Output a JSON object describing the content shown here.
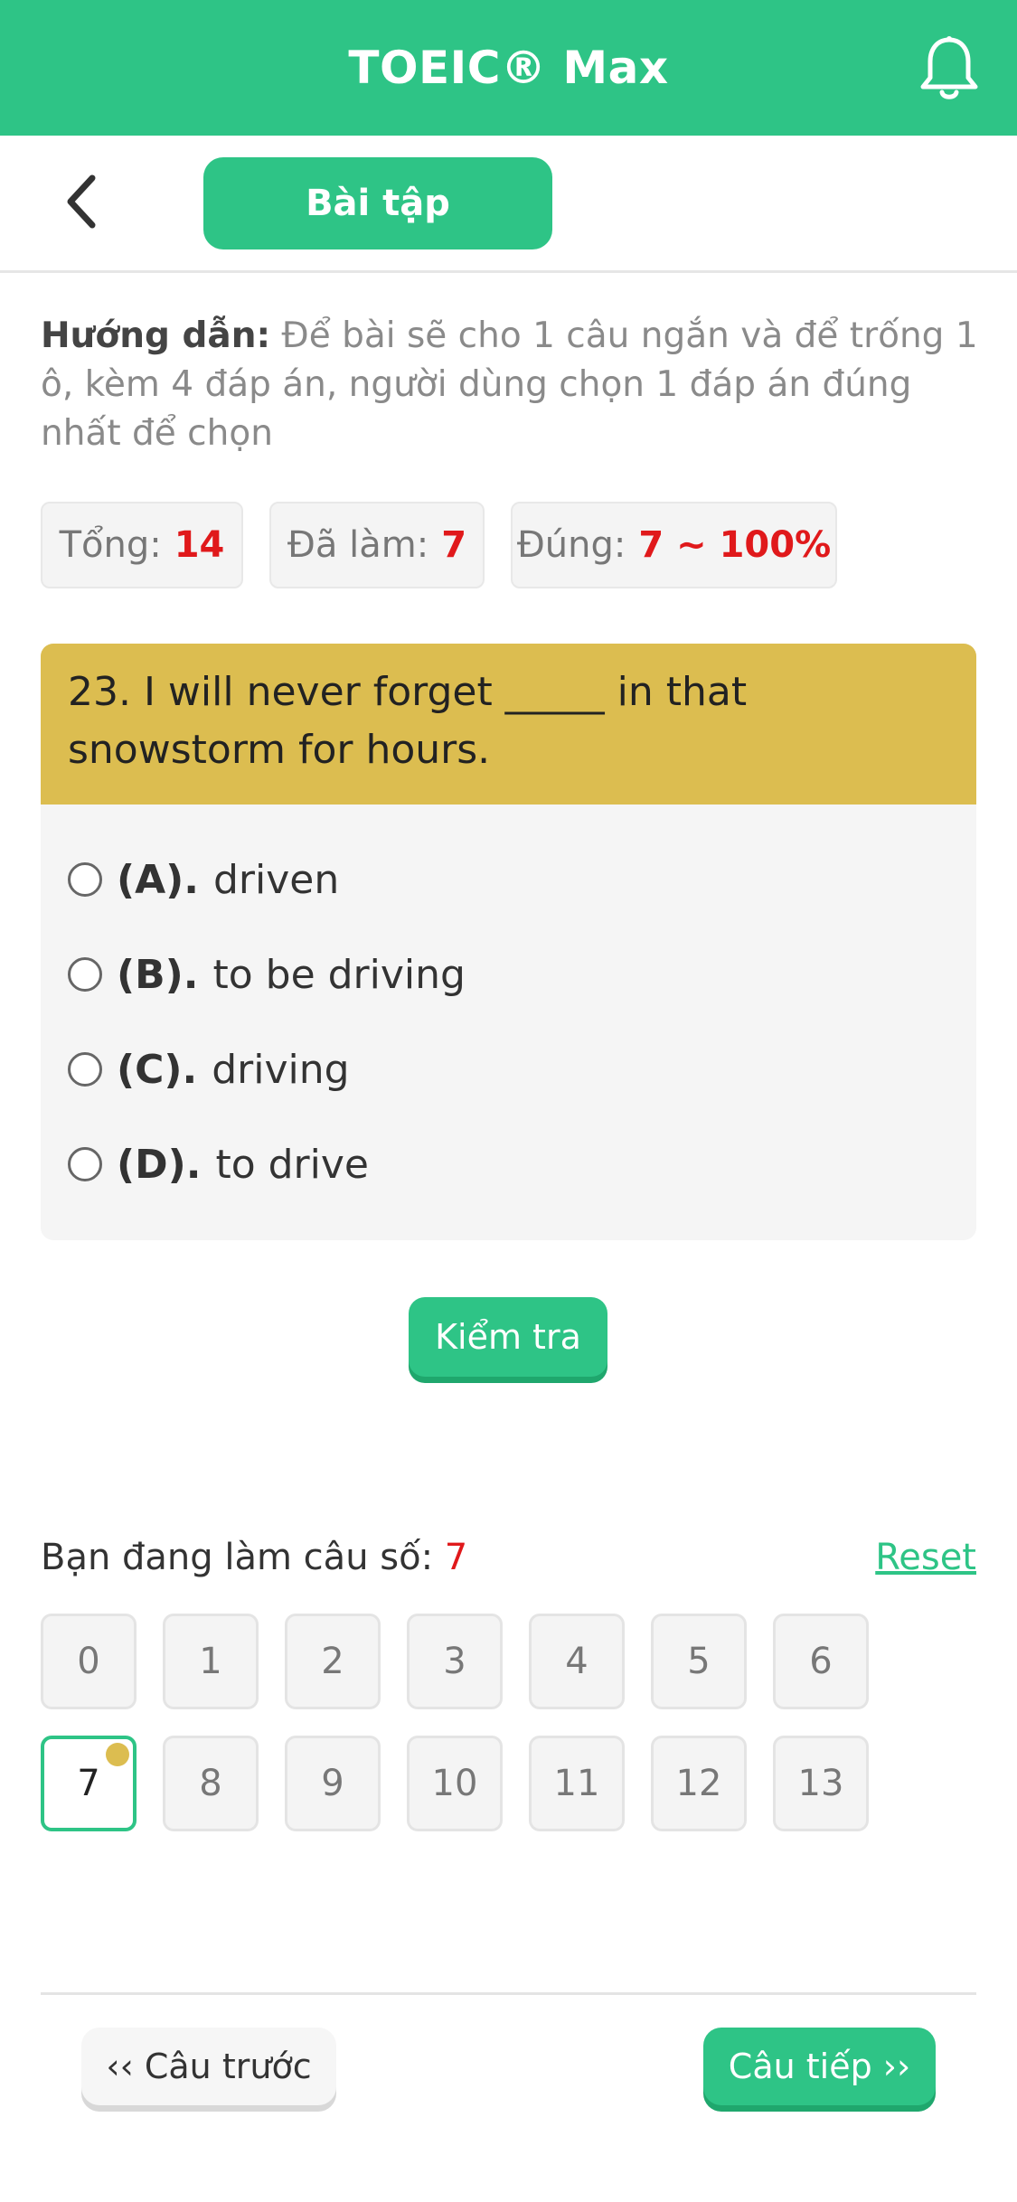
{
  "header": {
    "title": "TOEIC® Max",
    "bell_icon": "bell-icon",
    "accent_color": "#2ec486"
  },
  "subheader": {
    "back_icon": "chevron-left-icon",
    "tab_label": "Bài tập"
  },
  "instructions": {
    "label": "Hướng dẫn:",
    "text": "Để bài sẽ cho 1 câu ngắn và để trống 1 ô, kèm 4 đáp án, người dùng chọn 1 đáp án đúng nhất để chọn"
  },
  "stats": {
    "total_label": "Tổng:",
    "total_value": "14",
    "done_label": "Đã làm:",
    "done_value": "7",
    "correct_label": "Đúng:",
    "correct_value": "7 ~ 100%"
  },
  "question": {
    "text": "23. I will never forget _____ in that snowstorm for hours.",
    "options": [
      {
        "letter": "(A).",
        "text": "driven"
      },
      {
        "letter": "(B).",
        "text": "to be driving"
      },
      {
        "letter": "(C).",
        "text": "driving"
      },
      {
        "letter": "(D).",
        "text": "to drive"
      }
    ]
  },
  "check_button": "Kiểm tra",
  "progress": {
    "current_label": "Bạn đang làm câu số:",
    "current_value": "7",
    "reset_label": "Reset",
    "numbers": [
      "0",
      "1",
      "2",
      "3",
      "4",
      "5",
      "6",
      "7",
      "8",
      "9",
      "10",
      "11",
      "12",
      "13"
    ],
    "active_index": 7
  },
  "nav": {
    "prev_label": "‹‹ Câu trước",
    "next_label": "Câu tiếp ››"
  }
}
